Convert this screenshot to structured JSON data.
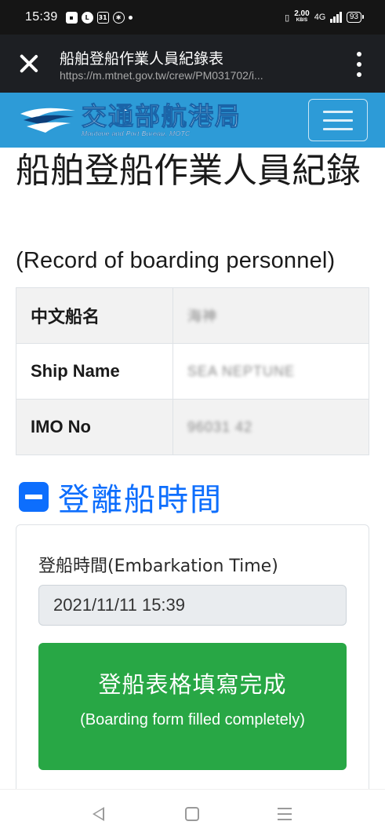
{
  "status_bar": {
    "time": "15:39",
    "speed_value": "2.00",
    "speed_unit": "KB/S",
    "network": "4G",
    "battery": "93",
    "left_icons": [
      "message-icon",
      "line-icon",
      "calendar-31-icon",
      "settings-gear-icon",
      "notification-dot"
    ]
  },
  "browser": {
    "title": "船舶登船作業人員紀錄表",
    "url": "https://m.mtnet.gov.tw/crew/PM031702/i..."
  },
  "header": {
    "logo_cn": "交通部航港局",
    "logo_en": "Maritime and Port Bureau, MOTC",
    "brand_color": "#2d9bd7"
  },
  "main": {
    "title": "船舶登船作業人員紀錄",
    "subtitle": "(Record of boarding personnel)",
    "table": [
      {
        "label": "中文船名",
        "value": "海神"
      },
      {
        "label": "Ship Name",
        "value": "SEA NEPTUNE"
      },
      {
        "label": "IMO No",
        "value": "96031 42"
      }
    ],
    "section_title": "登離船時間",
    "embark_label": "登船時間(Embarkation Time)",
    "embark_value": "2021/11/11 15:39",
    "submit_cn": "登船表格填寫完成",
    "submit_en": "(Boarding form filled completely)",
    "accent_color": "#0d6efd",
    "button_color": "#28a745"
  },
  "nav": {
    "icons": [
      "back-icon",
      "home-icon",
      "recents-icon"
    ]
  }
}
